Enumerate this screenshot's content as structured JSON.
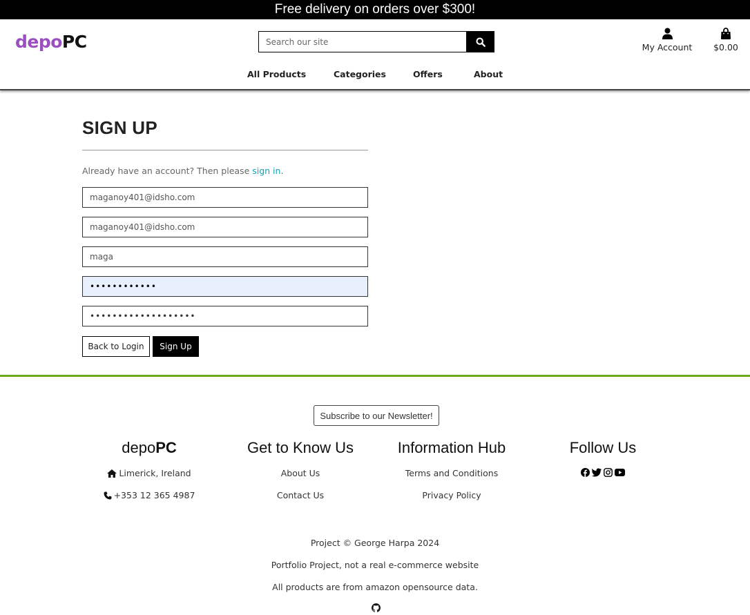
{
  "banner": {
    "text": "Free delivery on orders over $300!"
  },
  "header": {
    "logo_part1": "depo",
    "logo_part2": "PC",
    "search_placeholder": "Search our site",
    "account_label": "My Account",
    "cart_total": "$0.00"
  },
  "nav": {
    "items": [
      {
        "label": "All Products"
      },
      {
        "label": "Categories"
      },
      {
        "label": "Offers"
      },
      {
        "label": "About"
      }
    ]
  },
  "signup": {
    "title": "SIGN UP",
    "already_text": "Already have an account? Then please ",
    "signin_link": "sign in",
    "period": ".",
    "email": "maganoy401@idsho.com",
    "email_confirm": "maganoy401@idsho.com",
    "username": "maga",
    "password": "••••••••••••",
    "password_confirm": "•••••••••••••••••••",
    "back_label": "Back to Login",
    "submit_label": "Sign Up"
  },
  "footer": {
    "newsletter_label": "Subscribe to our Newsletter!",
    "brand_part1": "depo",
    "brand_part2": "PC",
    "location": "Limerick, Ireland",
    "phone": "+353 12 365 4987",
    "col2_title": "Get to Know Us",
    "col2_links": [
      "About Us",
      "Contact Us"
    ],
    "col3_title": "Information Hub",
    "col3_links": [
      "Terms and Conditions",
      "Privacy Policy"
    ],
    "col4_title": "Follow Us",
    "social_icons": [
      "facebook-icon",
      "twitter-icon",
      "instagram-icon",
      "youtube-icon"
    ],
    "copyright": "Project © George Harpa 2024",
    "disclaimer": "Portfolio Project, not a real e-commerce website",
    "data_note": "All products are from amazon opensource data."
  },
  "colors": {
    "logo_accent": "#9a4fc0",
    "link": "#17a2b8",
    "footer_rule": "#6aaa1a",
    "autofill_bg": "#e8f0fe"
  }
}
